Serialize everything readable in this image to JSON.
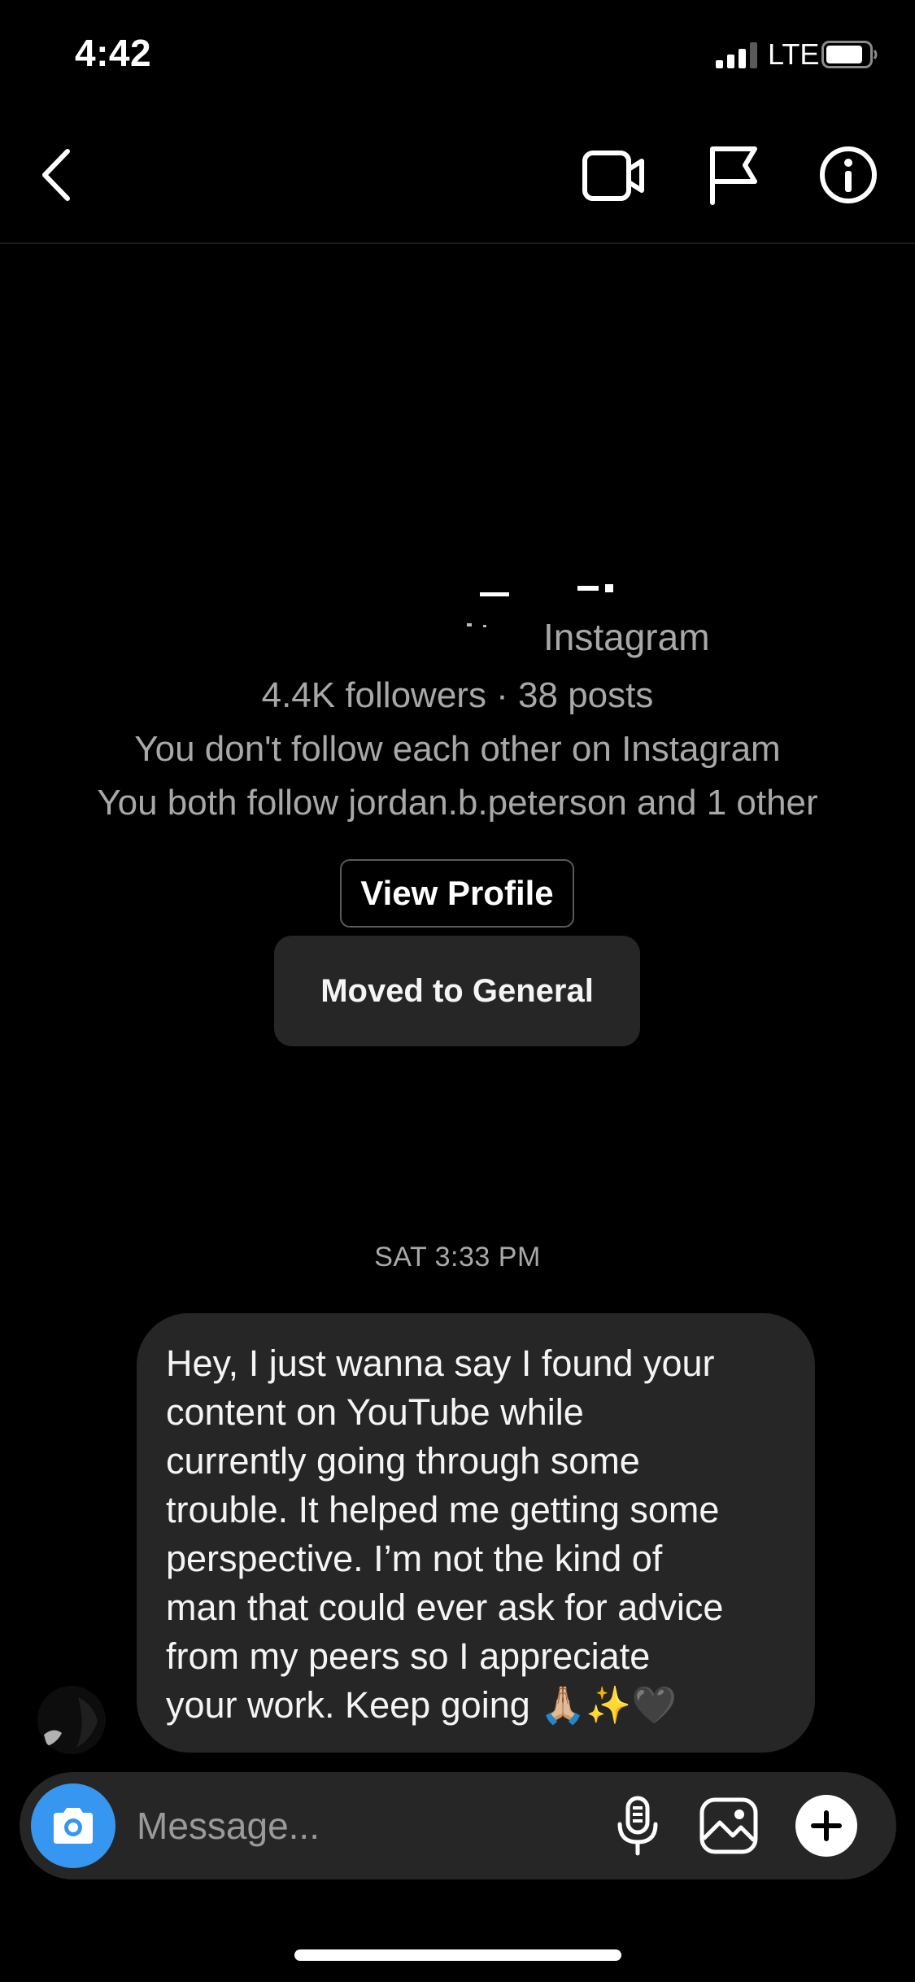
{
  "status_bar": {
    "time": "4:42",
    "network": "LTE"
  },
  "nav": {
    "back_icon": "chevron-left-icon",
    "video_icon": "video-call-icon",
    "report_icon": "flag-icon",
    "info_icon": "info-icon"
  },
  "profile": {
    "platform": "Instagram",
    "followers_line": "4.4K followers · 38 posts",
    "follow_status": "You don't follow each other on Instagram",
    "mutual": "You both follow jordan.b.peterson and 1 other",
    "view_profile_label": "View Profile",
    "moved_label": "Moved to General"
  },
  "conversation": {
    "timestamp": "SAT 3:33 PM",
    "messages": [
      {
        "text": "Hey, I just wanna say I found your\ncontent on YouTube while\ncurrently going through some\ntrouble. It helped me getting some\nperspective. I’m not the kind of\nman that could ever ask for advice\nfrom my peers so I appreciate\nyour work. Keep going 🙏🏼✨🖤"
      }
    ]
  },
  "composer": {
    "placeholder": "Message...",
    "camera_icon": "camera-icon",
    "mic_icon": "microphone-icon",
    "gallery_icon": "gallery-icon",
    "plus_icon": "plus-icon"
  },
  "colors": {
    "background": "#000000",
    "bubble": "#262626",
    "accent": "#3797f0",
    "secondary_text": "#a8a8a8"
  }
}
